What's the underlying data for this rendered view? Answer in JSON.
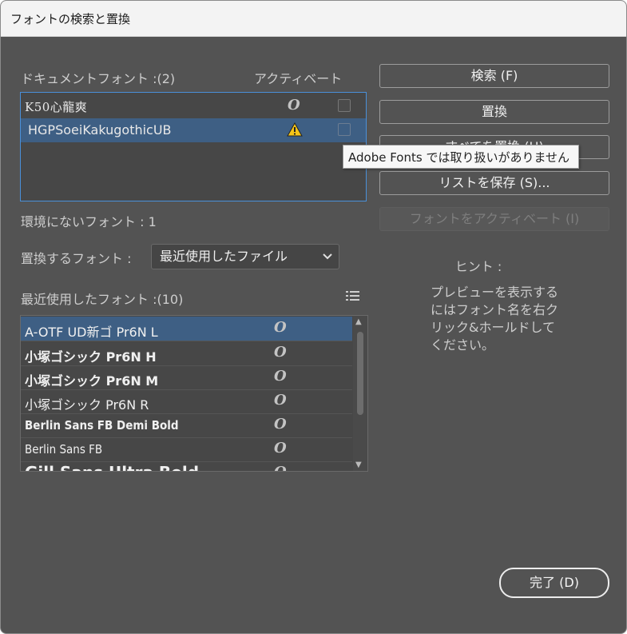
{
  "window": {
    "title": "フォントの検索と置換"
  },
  "document_fonts": {
    "label": "ドキュメントフォント :(2)",
    "activate_header": "アクティベート",
    "items": [
      {
        "name": "K50心龍爽",
        "type_icon": "opentype-icon",
        "checked": false
      },
      {
        "name": "HGPSoeiKakugothicUB",
        "type_icon": "warning-icon",
        "checked": false,
        "selected": true
      }
    ]
  },
  "tooltip": "Adobe Fonts では取り扱いがありません",
  "missing": "環境にないフォント : 1",
  "replace_with": {
    "label": "置換するフォント :",
    "selected": "最近使用したファイル"
  },
  "recent": {
    "label": "最近使用したフォント :(10)",
    "items": [
      {
        "name": "A-OTF UD新ゴ Pr6N L"
      },
      {
        "name": "小塚ゴシック Pr6N H"
      },
      {
        "name": "小塚ゴシック Pr6N M"
      },
      {
        "name": "小塚ゴシック Pr6N R"
      },
      {
        "name": "Berlin Sans FB Demi Bold"
      },
      {
        "name": "Berlin Sans FB"
      },
      {
        "name": "Gill Sans Ultra Bold"
      }
    ]
  },
  "buttons": {
    "find": "検索 (F)",
    "replace": "置換",
    "replace_all": "すべてを置換 (H)",
    "save_list": "リストを保存 (S)...",
    "activate": "フォントをアクティベート (I)",
    "done": "完了 (D)"
  },
  "hint": {
    "title": "ヒント :",
    "body": "プレビューを表示するにはフォント名を右クリック&ホールドしてください。"
  }
}
